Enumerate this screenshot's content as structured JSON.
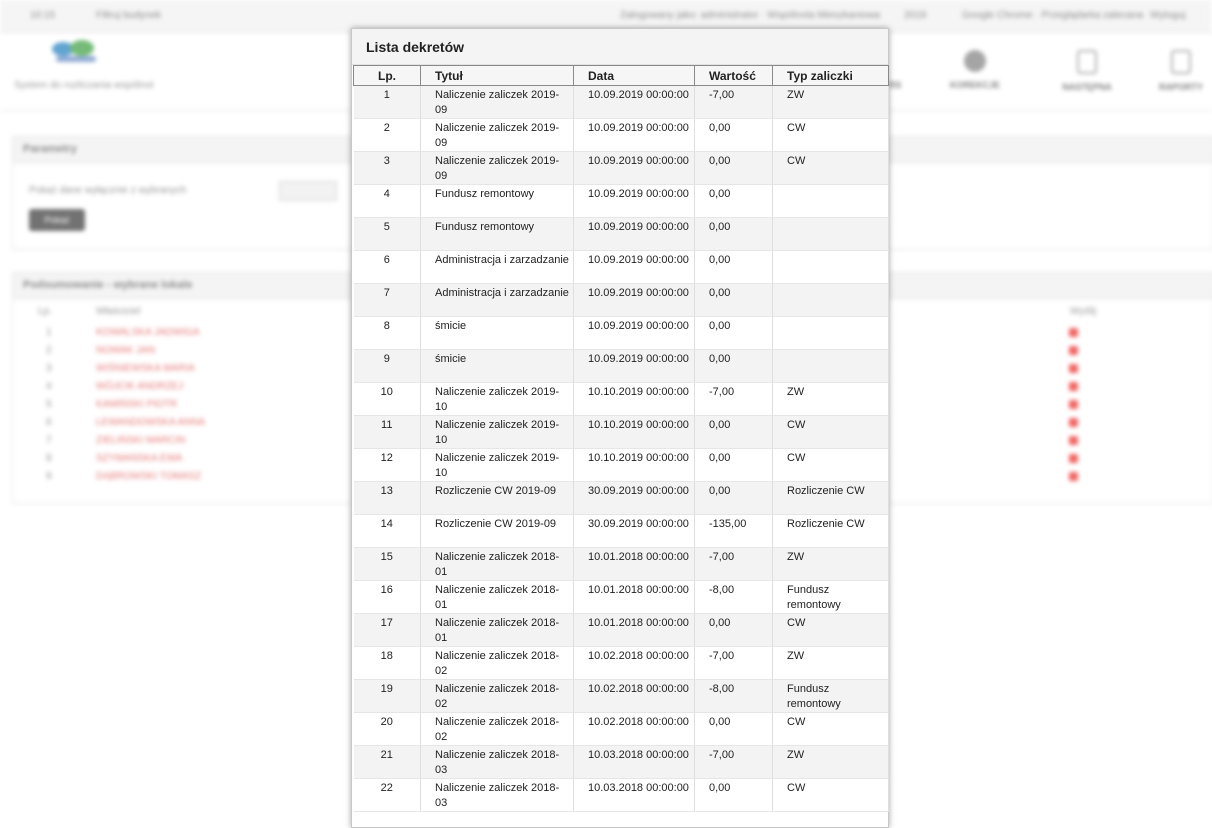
{
  "background": {
    "topbar": {
      "left_a": "10:15",
      "search": "Filtruj budynek",
      "center": "Zalogowany jako: administrator · Wspólnota Mieszkaniowa",
      "date": "2019",
      "google": "Google Chrome · Przeglądarka zalecana",
      "right": "Wyloguj"
    },
    "logo_subtitle": "System do rozliczania wspólnot",
    "nav": [
      "RS",
      "KOREKCJE",
      "NASTĘPNA",
      "RAPORTY"
    ],
    "panel_params": {
      "title": "Parametry",
      "label": "Pokaż dane wyłącznie z wybranych",
      "button": "Pokaż"
    },
    "panel_list": {
      "title": "Podsumowanie - wybrane lokale",
      "col_lp": "Lp.",
      "col_name": "Właściciel",
      "col_right": "Wyślij"
    },
    "rows": [
      {
        "n": "1",
        "name": "KOWALSKA JADWIGA"
      },
      {
        "n": "2",
        "name": "NOWAK JAN"
      },
      {
        "n": "3",
        "name": "WIŚNIEWSKA MARIA"
      },
      {
        "n": "4",
        "name": "WÓJCIK ANDRZEJ"
      },
      {
        "n": "5",
        "name": "KAMIŃSKI PIOTR"
      },
      {
        "n": "6",
        "name": "LEWANDOWSKA ANNA"
      },
      {
        "n": "7",
        "name": "ZIELIŃSKI MARCIN"
      },
      {
        "n": "8",
        "name": "SZYMAŃSKA EWA"
      },
      {
        "n": "9",
        "name": "DĄBROWSKI TOMASZ"
      }
    ]
  },
  "modal": {
    "title": "Lista dekretów",
    "columns": [
      "Lp.",
      "Tytuł",
      "Data",
      "Wartość",
      "Typ zaliczki"
    ],
    "rows": [
      {
        "lp": "1",
        "tytul": "Naliczenie zaliczek 2019-09",
        "data": "10.09.2019 00:00:00",
        "wartosc": "-7,00",
        "typ": "ZW"
      },
      {
        "lp": "2",
        "tytul": "Naliczenie zaliczek 2019-09",
        "data": "10.09.2019 00:00:00",
        "wartosc": "0,00",
        "typ": "CW"
      },
      {
        "lp": "3",
        "tytul": "Naliczenie zaliczek 2019-09",
        "data": "10.09.2019 00:00:00",
        "wartosc": "0,00",
        "typ": "CW"
      },
      {
        "lp": "4",
        "tytul": "Fundusz remontowy",
        "data": "10.09.2019 00:00:00",
        "wartosc": "0,00",
        "typ": ""
      },
      {
        "lp": "5",
        "tytul": "Fundusz remontowy",
        "data": "10.09.2019 00:00:00",
        "wartosc": "0,00",
        "typ": ""
      },
      {
        "lp": "6",
        "tytul": "Administracja i zarzadzanie",
        "data": "10.09.2019 00:00:00",
        "wartosc": "0,00",
        "typ": ""
      },
      {
        "lp": "7",
        "tytul": "Administracja i zarzadzanie",
        "data": "10.09.2019 00:00:00",
        "wartosc": "0,00",
        "typ": ""
      },
      {
        "lp": "8",
        "tytul": "śmicie",
        "data": "10.09.2019 00:00:00",
        "wartosc": "0,00",
        "typ": ""
      },
      {
        "lp": "9",
        "tytul": "śmicie",
        "data": "10.09.2019 00:00:00",
        "wartosc": "0,00",
        "typ": ""
      },
      {
        "lp": "10",
        "tytul": "Naliczenie zaliczek 2019-10",
        "data": "10.10.2019 00:00:00",
        "wartosc": "-7,00",
        "typ": "ZW"
      },
      {
        "lp": "11",
        "tytul": "Naliczenie zaliczek 2019-10",
        "data": "10.10.2019 00:00:00",
        "wartosc": "0,00",
        "typ": "CW"
      },
      {
        "lp": "12",
        "tytul": "Naliczenie zaliczek 2019-10",
        "data": "10.10.2019 00:00:00",
        "wartosc": "0,00",
        "typ": "CW"
      },
      {
        "lp": "13",
        "tytul": "Rozliczenie CW 2019-09",
        "data": "30.09.2019 00:00:00",
        "wartosc": "0,00",
        "typ": "Rozliczenie CW"
      },
      {
        "lp": "14",
        "tytul": "Rozliczenie CW 2019-09",
        "data": "30.09.2019 00:00:00",
        "wartosc": "-135,00",
        "typ": "Rozliczenie CW"
      },
      {
        "lp": "15",
        "tytul": "Naliczenie zaliczek 2018-01",
        "data": "10.01.2018 00:00:00",
        "wartosc": "-7,00",
        "typ": "ZW"
      },
      {
        "lp": "16",
        "tytul": "Naliczenie zaliczek 2018-01",
        "data": "10.01.2018 00:00:00",
        "wartosc": "-8,00",
        "typ": "Fundusz remontowy"
      },
      {
        "lp": "17",
        "tytul": "Naliczenie zaliczek 2018-01",
        "data": "10.01.2018 00:00:00",
        "wartosc": "0,00",
        "typ": "CW"
      },
      {
        "lp": "18",
        "tytul": "Naliczenie zaliczek 2018-02",
        "data": "10.02.2018 00:00:00",
        "wartosc": "-7,00",
        "typ": "ZW"
      },
      {
        "lp": "19",
        "tytul": "Naliczenie zaliczek 2018-02",
        "data": "10.02.2018 00:00:00",
        "wartosc": "-8,00",
        "typ": "Fundusz remontowy"
      },
      {
        "lp": "20",
        "tytul": "Naliczenie zaliczek 2018-02",
        "data": "10.02.2018 00:00:00",
        "wartosc": "0,00",
        "typ": "CW"
      },
      {
        "lp": "21",
        "tytul": "Naliczenie zaliczek 2018-03",
        "data": "10.03.2018 00:00:00",
        "wartosc": "-7,00",
        "typ": "ZW"
      },
      {
        "lp": "22",
        "tytul": "Naliczenie zaliczek 2018-03",
        "data": "10.03.2018 00:00:00",
        "wartosc": "0,00",
        "typ": "CW"
      }
    ]
  }
}
